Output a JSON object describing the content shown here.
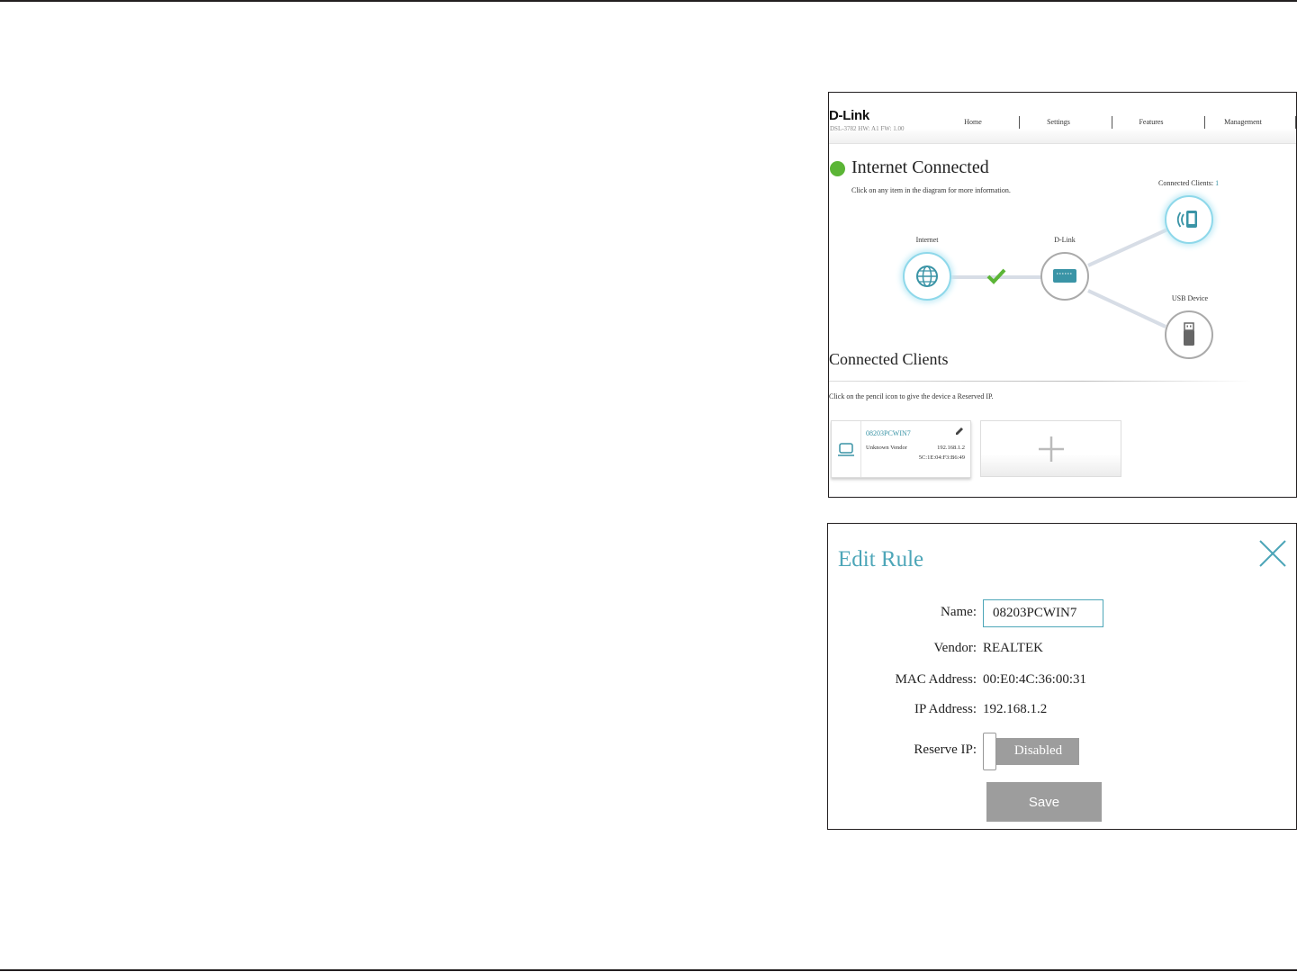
{
  "home": {
    "logo": "D-Link",
    "model_info": "DSL-3782  HW: A1  FW: 1.00",
    "nav": [
      "Home",
      "Settings",
      "Features",
      "Management"
    ],
    "status_title": "Internet Connected",
    "status_hint": "Click on any item in the diagram for more information.",
    "nodes": {
      "internet": "Internet",
      "router": "D-Link",
      "clients_label": "Connected Clients:",
      "clients_count": "1",
      "usb": "USB Device"
    },
    "colors": {
      "accent": "#3a94a6",
      "connected_green": "#5bb536"
    },
    "clients_section": {
      "title": "Connected Clients",
      "hint": "Click on the pencil icon to give the device a Reserved IP.",
      "clients": [
        {
          "name": "08203PCWIN7",
          "vendor": "Unknown Vendor",
          "ip": "192.168.1.2",
          "mac": "5C:1E:04:F3:B6:49"
        }
      ]
    }
  },
  "edit_rule": {
    "title": "Edit Rule",
    "name_label": "Name:",
    "name_value": "08203PCWIN7",
    "vendor_label": "Vendor:",
    "vendor_value": "REALTEK",
    "mac_label": "MAC Address:",
    "mac_value": "00:E0:4C:36:00:31",
    "ip_label": "IP Address:",
    "ip_value": "192.168.1.2",
    "reserve_label": "Reserve IP:",
    "reserve_state": "Disabled",
    "save_label": "Save"
  }
}
